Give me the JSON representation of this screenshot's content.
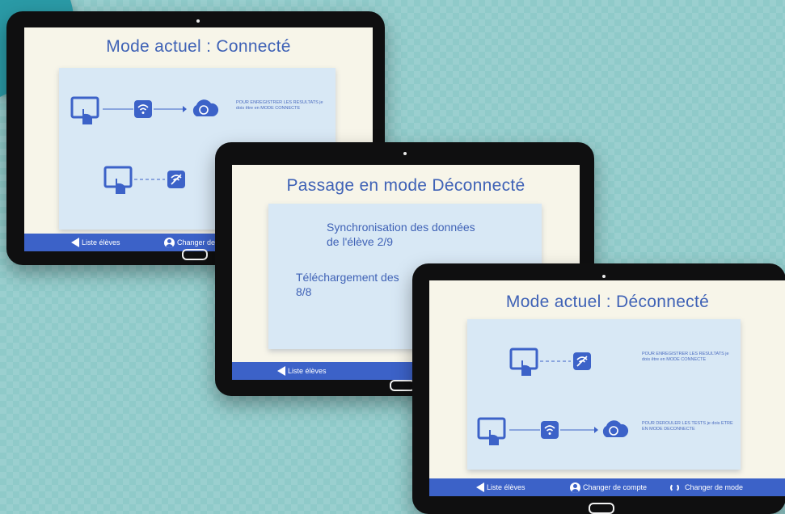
{
  "tablet_connected": {
    "title": "Mode actuel : Connecté",
    "description_top": "POUR ENREGISTRER LES RESULTATS je dois être en MODE CONNECTE",
    "bottom_bar": {
      "back_label": "Liste élèves",
      "account_label": "Changer de"
    }
  },
  "tablet_passage": {
    "title": "Passage en mode Déconnecté",
    "sync_line1": "Synchronisation des données",
    "sync_line2": "de l'élève 2/9",
    "download_line1": "Téléchargement des",
    "download_line2": "8/8",
    "bottom_bar": {
      "back_label": "Liste élèves"
    }
  },
  "tablet_disconnected": {
    "title": "Mode actuel : Déconnecté",
    "description_top": "POUR ENREGISTRER LES RESULTATS je dois être en MODE CONNECTE",
    "description_bottom": "POUR DEROULER LES TESTS je dois ETRE EN MODE DECONNECTE",
    "bottom_bar": {
      "back_label": "Liste élèves",
      "account_label": "Changer de compte",
      "mode_label": "Changer de mode"
    }
  },
  "colors": {
    "accent": "#3c62c8",
    "title_blue": "#3f62b6",
    "panel": "#d8e8f5",
    "screen_bg": "#f7f5e9",
    "background": "#8fcac9"
  },
  "icons": [
    "tablet-touch-icon",
    "wifi-icon",
    "wifi-off-icon",
    "cloud-sync-icon",
    "arrow-left-icon",
    "user-icon",
    "refresh-icon"
  ]
}
